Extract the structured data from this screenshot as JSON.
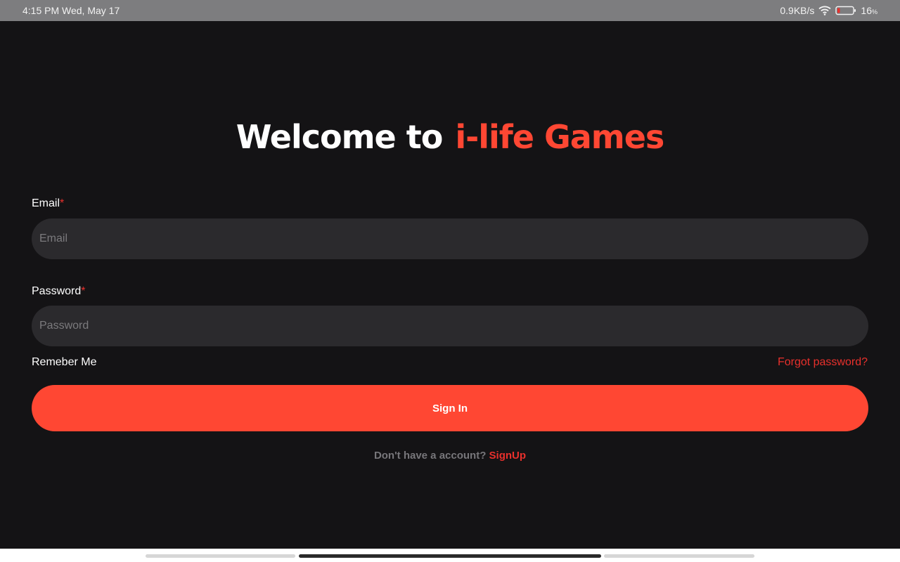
{
  "status_bar": {
    "time_date": "4:15 PM Wed, May 17",
    "net_speed": "0.9KB/s",
    "battery_pct": "16",
    "battery_unit": "%",
    "icons": [
      "wifi-icon",
      "battery-icon"
    ]
  },
  "header": {
    "welcome": "Welcome to",
    "brand": "i-life Games"
  },
  "form": {
    "email_label": "Email",
    "email_required": "*",
    "email_placeholder": "Email",
    "password_label": "Password",
    "password_required": "*",
    "password_placeholder": "Password",
    "remember_label": "Remeber Me",
    "forgot_label": "Forgot password?",
    "signin_label": "Sign In",
    "no_account_text": "Don't have a account?",
    "signup_label": "SignUp"
  },
  "colors": {
    "background": "#141315",
    "accent": "#ff4733",
    "link": "#e8302c",
    "input_bg": "#2b2a2d"
  }
}
